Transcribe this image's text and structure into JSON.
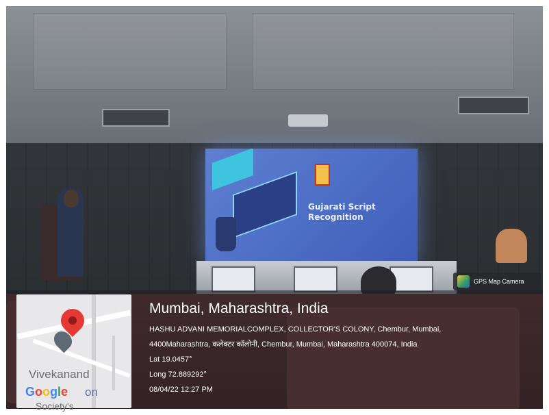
{
  "slide": {
    "title_line1": "Gujarati Script",
    "title_line2": "Recognition"
  },
  "gps_camera": {
    "label": "GPS Map Camera",
    "icon": "gps-map-camera-icon"
  },
  "map": {
    "place_label": "Vivekanand",
    "brand_letters": [
      "G",
      "o",
      "o",
      "g",
      "l",
      "e"
    ],
    "brand_suffix": "on",
    "cut_label": "Society's",
    "pin_color": "#e53935"
  },
  "location": {
    "title": "Mumbai, Maharashtra, India",
    "address_line1": "HASHU ADVANI MEMORIALCOMPLEX, COLLECTOR'S COLONY, Chembur, Mumbai,",
    "address_line2": "4400Maharashtra, कलेक्टर कॉलोनी, Chembur, Mumbai, Maharashtra 400074, India",
    "lat": "Lat 19.0457°",
    "long": "Long 72.889292°",
    "datetime": "08/04/22 12:27 PM"
  }
}
